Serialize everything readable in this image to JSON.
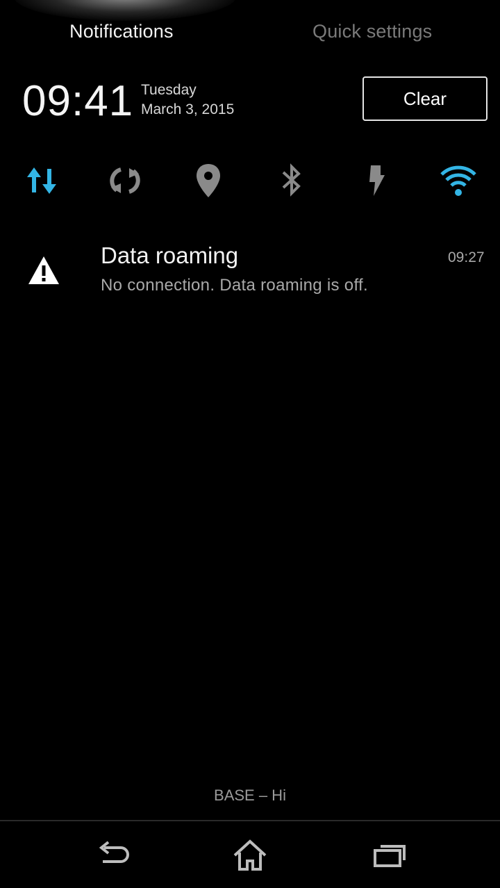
{
  "tabs": {
    "notifications": "Notifications",
    "quick_settings": "Quick settings"
  },
  "header": {
    "time": "09:41",
    "day": "Tuesday",
    "date": "March 3, 2015",
    "clear_label": "Clear"
  },
  "toggles": [
    {
      "icon": "mobile-data-icon",
      "active": true
    },
    {
      "icon": "sync-icon",
      "active": false
    },
    {
      "icon": "location-icon",
      "active": false
    },
    {
      "icon": "bluetooth-icon",
      "active": false
    },
    {
      "icon": "flashlight-icon",
      "active": false
    },
    {
      "icon": "wifi-icon",
      "active": true
    }
  ],
  "notification": {
    "title": "Data roaming",
    "text": "No connection. Data roaming is off.",
    "time": "09:27",
    "icon": "warning-icon"
  },
  "carrier": "BASE – Hi",
  "colors": {
    "active": "#33b5e5",
    "inactive": "#8a8a8a",
    "background": "#000000"
  }
}
